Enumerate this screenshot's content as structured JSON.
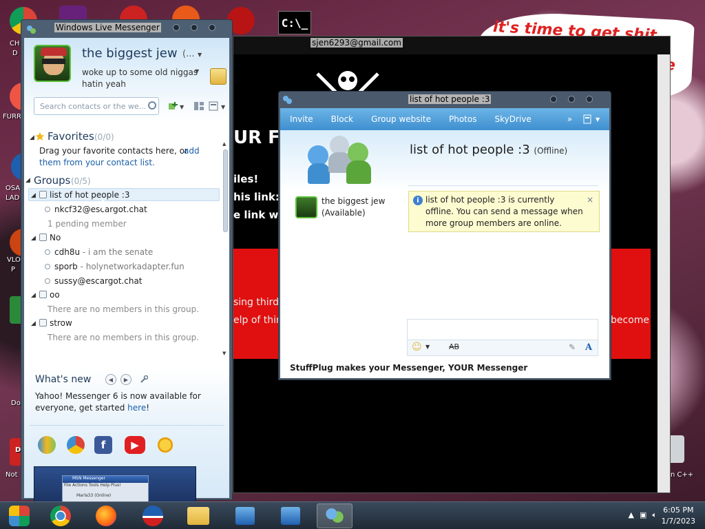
{
  "desktop": {
    "labels": [
      "CH",
      "D",
      "FURR",
      "OSA",
      "LAD",
      "VLO",
      "P",
      "Do",
      "D",
      "Not",
      "n C++"
    ]
  },
  "background_window": {
    "title": "sjen6293@gmail.com",
    "headline": "UR FI",
    "lines": [
      "iles!",
      "his link: c",
      "e link wi"
    ],
    "red_text_1": "sing third p",
    "red_text_2": "elp of third",
    "red_text_3": "become",
    "speech_text_1": "it's time to get shit",
    "speech_text_2": "te"
  },
  "messenger": {
    "window_title": "Windows Live Messenger",
    "display_name": "the biggest jew",
    "display_name_suffix": "(...",
    "status_message": "woke up to some old niggas hatin yeah",
    "search_placeholder": "Search contacts or the we...",
    "favorites": {
      "label": "Favorites",
      "count": "(0/0)",
      "hint_text": "Drag your favorite contacts here, or",
      "hint_link_1": "add",
      "hint_link_2": "them from your contact list."
    },
    "groups": {
      "label": "Groups",
      "count": "(0/5)"
    },
    "contact_rows": [
      {
        "name": "list of hot people :3"
      },
      {
        "name": "nkcf32@escargot.chat"
      },
      {
        "name": "1 pending member"
      },
      {
        "name": "No"
      },
      {
        "name": "cdh8u",
        "psm": "- i am the senate"
      },
      {
        "name": "sporb",
        "psm": "- holynetworkadapter.fun"
      },
      {
        "name": "sussy@escargot.chat"
      },
      {
        "name": "oo"
      },
      {
        "name": "There are no members in this group."
      },
      {
        "name": "strow"
      },
      {
        "name": "There are no members in this group."
      }
    ],
    "whats_new": {
      "label": "What's new",
      "text": "Yahoo! Messenger 6 is now available for everyone, get started",
      "link": "here",
      "end": "!"
    },
    "ad": {
      "window_title": "MSN Messenger",
      "menu": "File  Actions  Tools  Help  Plus!",
      "contact": "Marla33 (Online)"
    }
  },
  "conversation": {
    "window_title": "list of hot people :3",
    "menu": [
      "Invite",
      "Block",
      "Group website",
      "Photos",
      "SkyDrive"
    ],
    "more": "»",
    "group_name": "list of hot people :3",
    "group_status": "(Offline)",
    "self_name": "the biggest jew",
    "self_status": "(Available)",
    "info_message": "list of hot people :3 is currently offline. You can send a message when more group members are online.",
    "info_close": "×",
    "footer": "StuffPlug makes your Messenger, YOUR Messenger"
  },
  "taskbar": {
    "time": "6:05 PM",
    "date": "1/7/2023"
  },
  "colors": {
    "accent": "#3f8fd0",
    "link": "#1a5ea8",
    "avatar_border": "#5bbf3a",
    "info_bg": "#fdfbd0",
    "alert_red": "#e01010"
  }
}
